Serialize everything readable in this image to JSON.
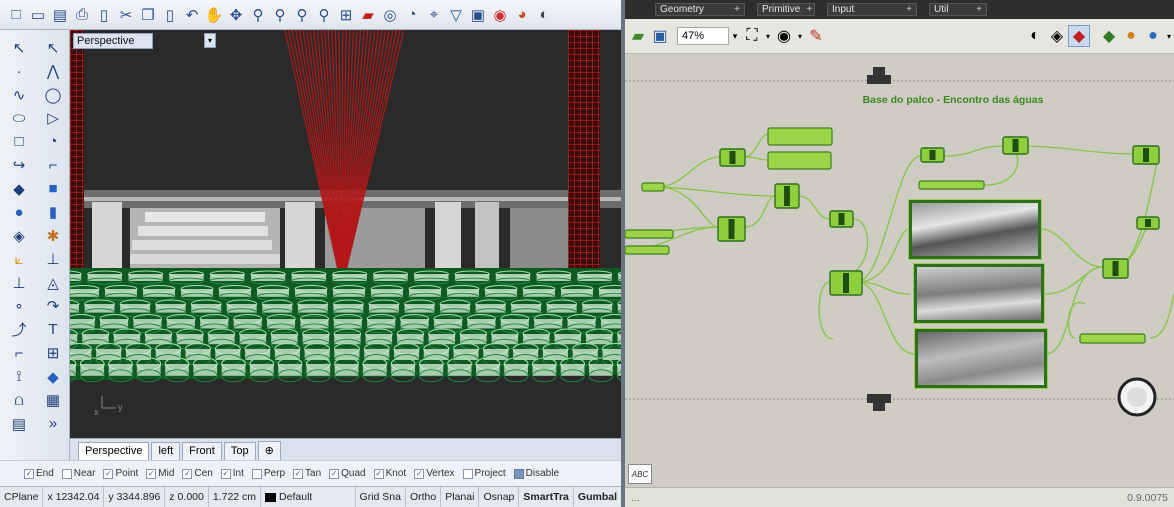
{
  "rhino": {
    "viewport_label": "Perspective",
    "axis_x": "x",
    "axis_y": "y",
    "view_tabs": [
      "Perspective",
      "left",
      "Front",
      "Top"
    ],
    "add_tab_glyph": "⊕",
    "osnaps": [
      {
        "label": "End",
        "checked": true
      },
      {
        "label": "Near",
        "checked": false
      },
      {
        "label": "Point",
        "checked": true
      },
      {
        "label": "Mid",
        "checked": true
      },
      {
        "label": "Cen",
        "checked": true
      },
      {
        "label": "Int",
        "checked": true
      },
      {
        "label": "Perp",
        "checked": false
      },
      {
        "label": "Tan",
        "checked": true
      },
      {
        "label": "Quad",
        "checked": true
      },
      {
        "label": "Knot",
        "checked": true
      },
      {
        "label": "Vertex",
        "checked": true
      },
      {
        "label": "Project",
        "checked": false
      },
      {
        "label": "Disable",
        "checked": true
      }
    ],
    "status": {
      "cplane": "CPlanе",
      "x": "x 12342.04",
      "y": "y 3344.896",
      "z": "z 0.000",
      "units": "1.722 cm",
      "layer": "Default",
      "grid_snap": "Grid Sna",
      "ortho": "Ortho",
      "planar": "Planai",
      "osnap": "Osnap",
      "smarttrack": "SmartTra",
      "gumball": "Gumbal"
    },
    "more_glyph": "»"
  },
  "grasshopper": {
    "tabs": [
      "Geometry",
      "Primitive",
      "Input",
      "Util"
    ],
    "zoom": "47%",
    "group_title": "Base do palco - Encontro das águas",
    "abc_label": "ABC",
    "status_left": "...",
    "version": "0.9.0075",
    "colors": {
      "canvas": "#cfcdc3",
      "node_green": "#8fce3c",
      "wire": "#86c442",
      "selected_border": "#2e6f1c"
    }
  }
}
